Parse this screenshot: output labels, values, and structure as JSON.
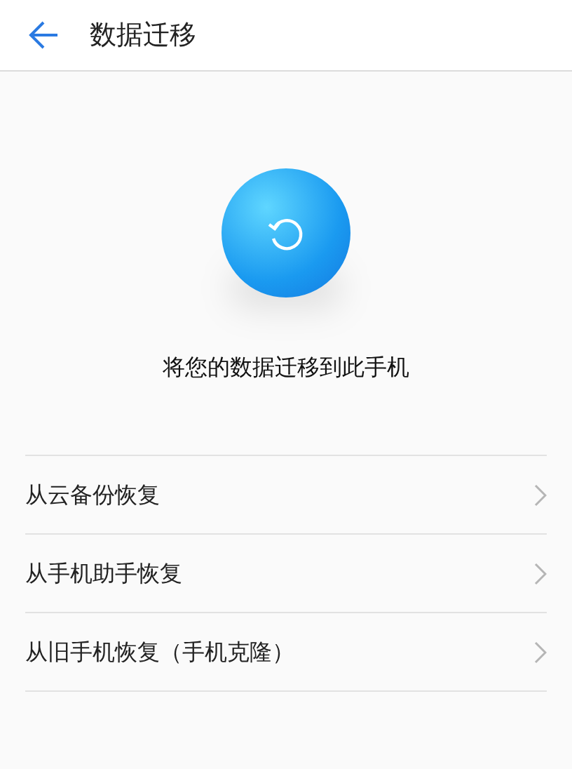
{
  "header": {
    "title": "数据迁移"
  },
  "hero": {
    "caption": "将您的数据迁移到此手机"
  },
  "options": [
    {
      "label": "从云备份恢复"
    },
    {
      "label": "从手机助手恢复"
    },
    {
      "label": "从旧手机恢复（手机克隆）"
    }
  ]
}
